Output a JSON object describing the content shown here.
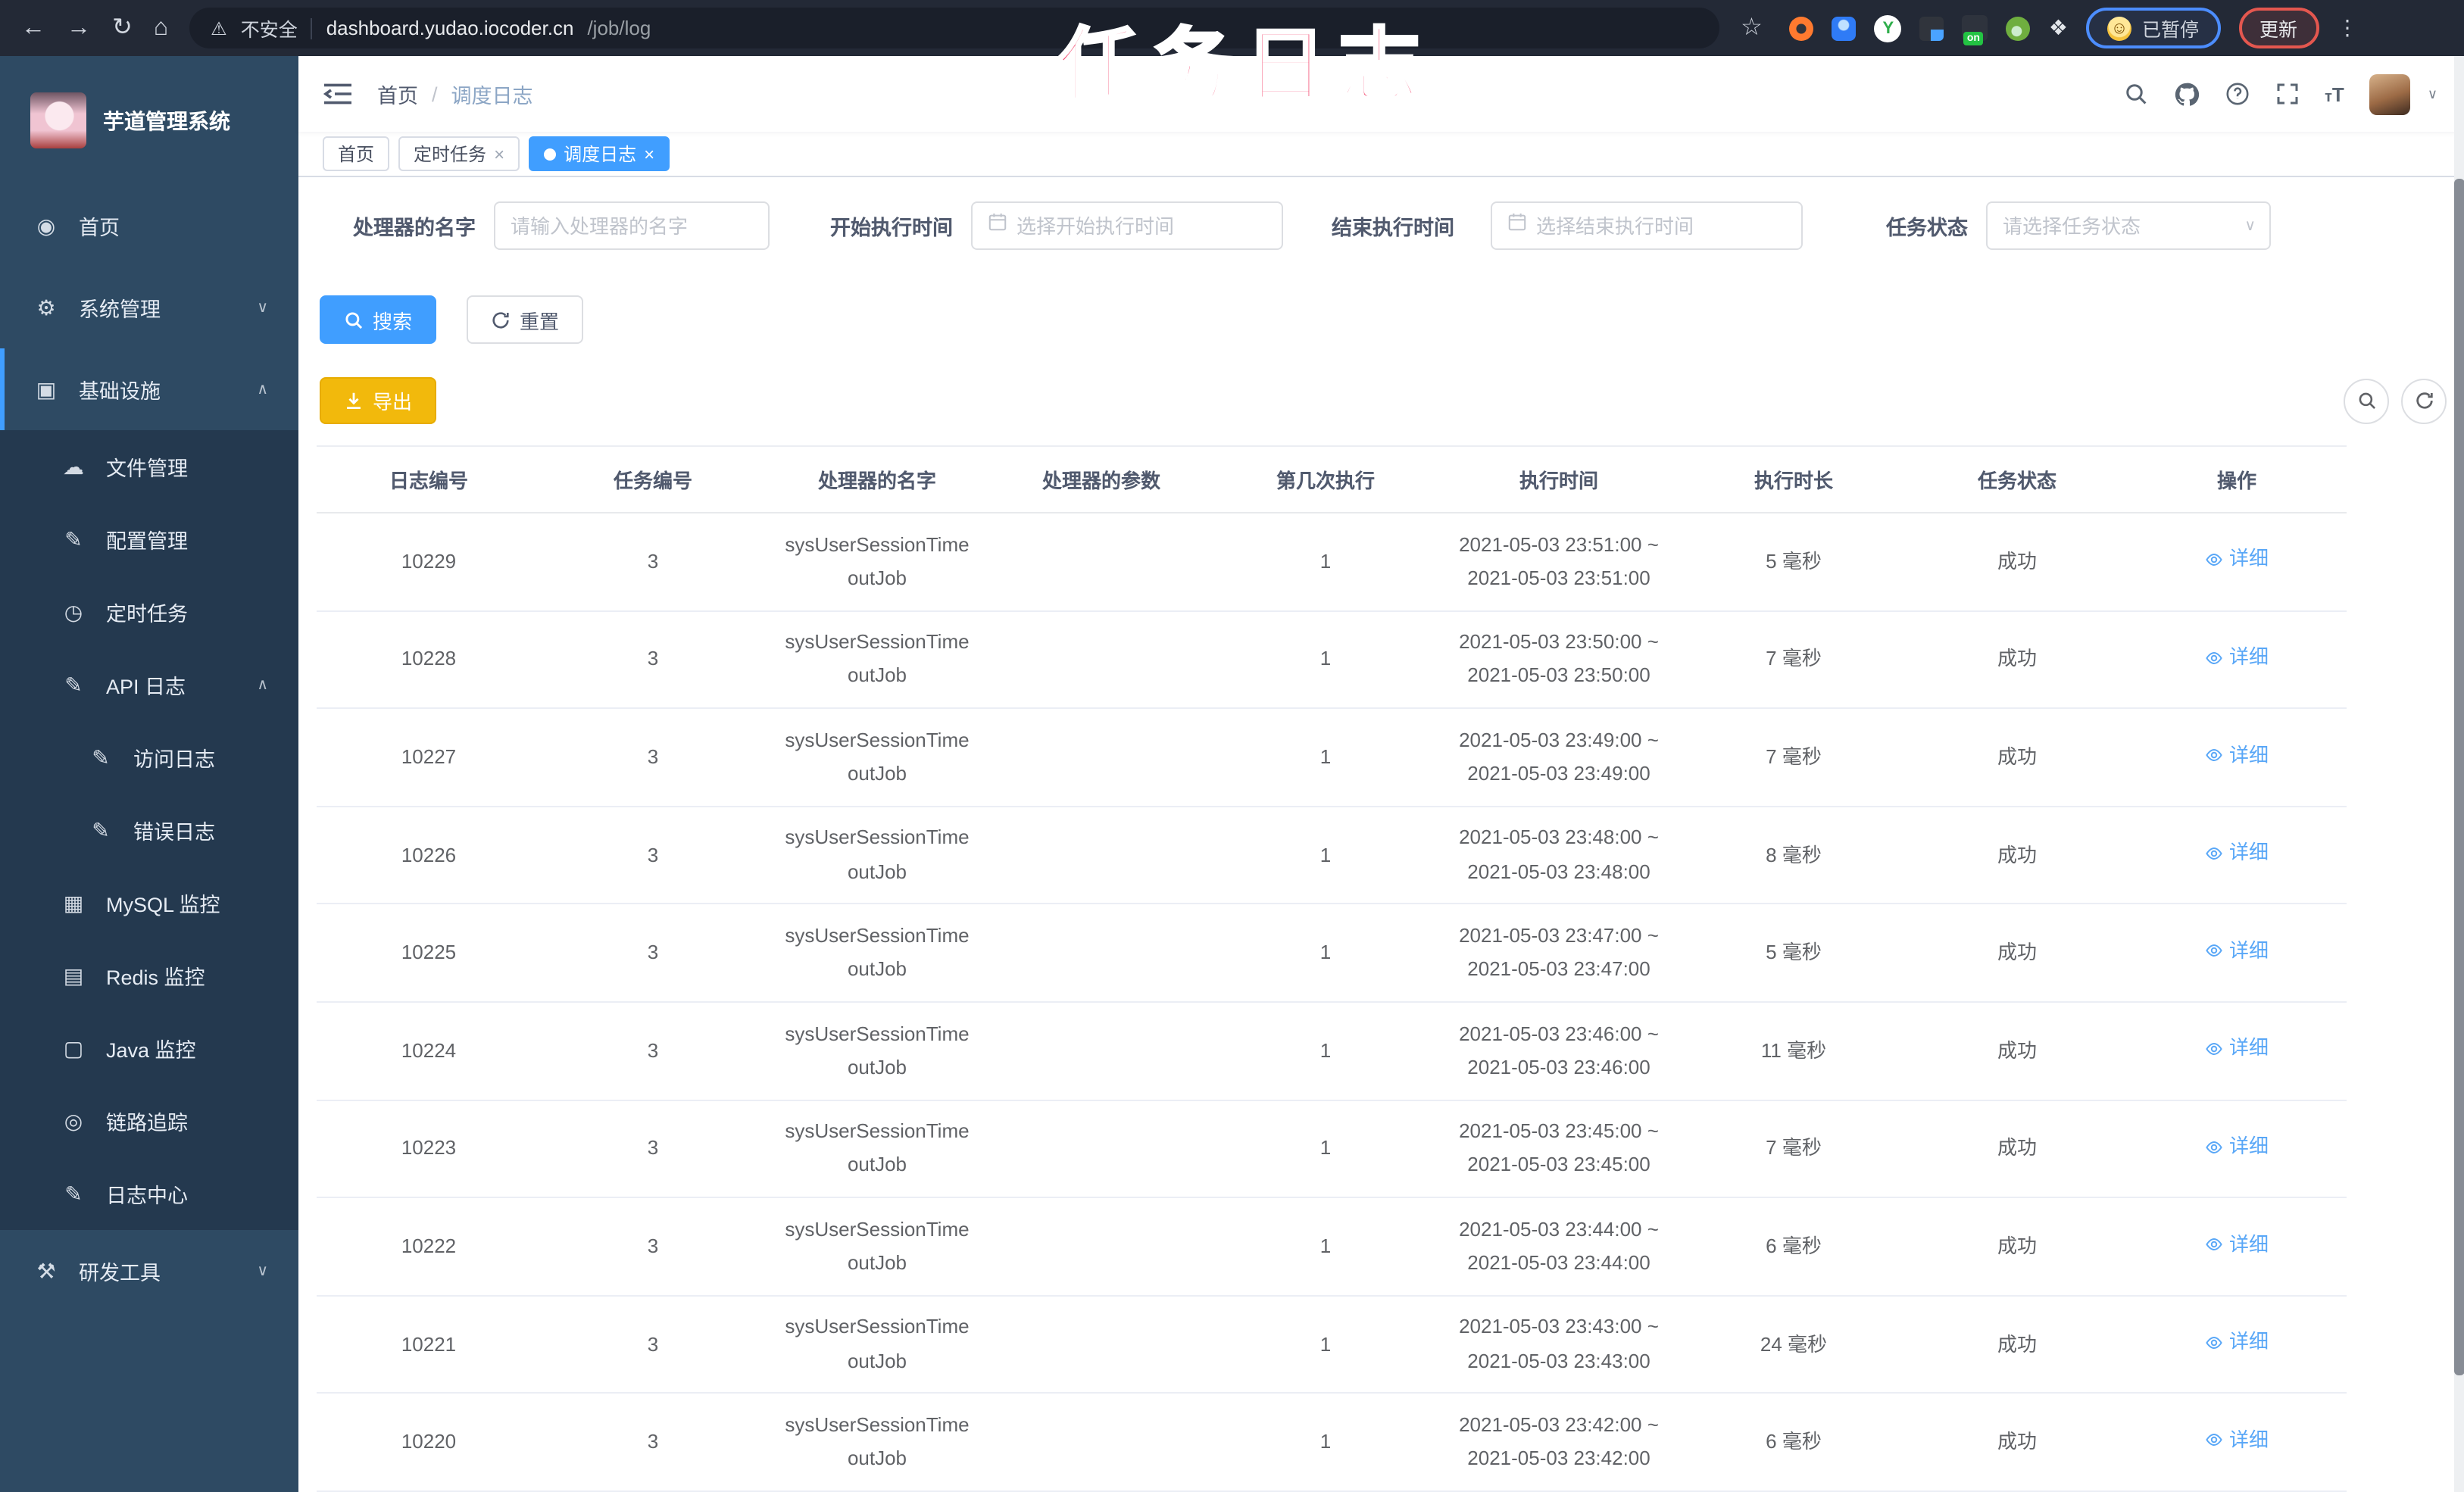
{
  "colors": {
    "accent": "#409eff",
    "warning_button": "#f2b90c",
    "annotation_pink": "#f23a64",
    "sidebar_bg": "#2e4a63",
    "sidebar_submenu_bg": "#24394f",
    "browser_bar_bg": "#232936",
    "active_tab_bg": "#409eff"
  },
  "browser": {
    "security_label": "不安全",
    "url_host": "dashboard.yudao.iocoder.cn",
    "url_path": "/job/log",
    "paused_label": "已暂停",
    "update_label": "更新",
    "extension_y_label": "Y",
    "extension_on_label": "on",
    "emoji_face_glyph": "☺",
    "back_glyph": "←",
    "forward_glyph": "→",
    "reload_glyph": "↻",
    "home_glyph": "⌂",
    "warning_glyph": "⚠",
    "star_glyph": "☆",
    "kebab_glyph": "⋮"
  },
  "annotation": {
    "title": "任务日志"
  },
  "sidebar": {
    "app_title": "芋道管理系统",
    "items": [
      {
        "label": "首页",
        "icon": "home-icon",
        "glyph": "◉",
        "arrow": "",
        "classes": "lvl1"
      },
      {
        "label": "系统管理",
        "icon": "system-gear-icon",
        "glyph": "⚙",
        "arrow": "∨",
        "classes": "lvl1"
      },
      {
        "label": "基础设施",
        "icon": "infrastructure-icon",
        "glyph": "▣",
        "arrow": "∧",
        "classes": "lvl1 active-section"
      },
      {
        "label": "文件管理",
        "icon": "file-cloud-icon",
        "glyph": "☁",
        "arrow": "",
        "classes": "lvl2"
      },
      {
        "label": "配置管理",
        "icon": "config-edit-icon",
        "glyph": "✎",
        "arrow": "",
        "classes": "lvl2"
      },
      {
        "label": "定时任务",
        "icon": "timer-icon",
        "glyph": "◷",
        "arrow": "",
        "classes": "lvl2"
      },
      {
        "label": "API 日志",
        "icon": "api-log-icon",
        "glyph": "✎",
        "arrow": "∧",
        "classes": "lvl2"
      },
      {
        "label": "访问日志",
        "icon": "access-log-icon",
        "glyph": "✎",
        "arrow": "",
        "classes": "lvl3"
      },
      {
        "label": "错误日志",
        "icon": "error-log-icon",
        "glyph": "✎",
        "arrow": "",
        "classes": "lvl3"
      },
      {
        "label": "MySQL 监控",
        "icon": "mysql-monitor-icon",
        "glyph": "▦",
        "arrow": "",
        "classes": "lvl2"
      },
      {
        "label": "Redis 监控",
        "icon": "redis-monitor-icon",
        "glyph": "▤",
        "arrow": "",
        "classes": "lvl2"
      },
      {
        "label": "Java 监控",
        "icon": "java-monitor-icon",
        "glyph": "▢",
        "arrow": "",
        "classes": "lvl2"
      },
      {
        "label": "链路追踪",
        "icon": "trace-eye-icon",
        "glyph": "◎",
        "arrow": "",
        "classes": "lvl2"
      },
      {
        "label": "日志中心",
        "icon": "log-center-icon",
        "glyph": "✎",
        "arrow": "",
        "classes": "lvl2"
      },
      {
        "label": "研发工具",
        "icon": "dev-tools-icon",
        "glyph": "⚒",
        "arrow": "∨",
        "classes": "lvl1"
      }
    ]
  },
  "header": {
    "breadcrumb_home": "首页",
    "breadcrumb_sep": "/",
    "breadcrumb_current": "调度日志",
    "font_size_icon_small": "т",
    "font_size_icon_large": "T",
    "avatar_caret": "∨"
  },
  "tabs": [
    {
      "label": "首页",
      "close": "",
      "classes": ""
    },
    {
      "label": "定时任务",
      "close": "×",
      "classes": ""
    },
    {
      "label": "调度日志",
      "close": "×",
      "classes": "active"
    }
  ],
  "filters": [
    {
      "label": "处理器的名字",
      "placeholder": "请输入处理器的名字",
      "classes": "type-text g1"
    },
    {
      "label": "开始执行时间",
      "placeholder": "选择开始执行时间",
      "classes": "type-date g2"
    },
    {
      "label": "结束执行时间",
      "placeholder": "选择结束执行时间",
      "classes": "type-date g3"
    },
    {
      "label": "任务状态",
      "placeholder": "请选择任务状态",
      "classes": "type-select g4",
      "caret": "∨"
    }
  ],
  "actions": {
    "search_label": "搜索",
    "reset_label": "重置",
    "export_label": "导出"
  },
  "table": {
    "columns": [
      {
        "label": "日志编号"
      },
      {
        "label": "任务编号"
      },
      {
        "label": "处理器的名字"
      },
      {
        "label": "处理器的参数"
      },
      {
        "label": "第几次执行"
      },
      {
        "label": "执行时间"
      },
      {
        "label": "执行时长"
      },
      {
        "label": "任务状态"
      },
      {
        "label": "操作"
      }
    ],
    "rows": [
      {
        "log_id": "10229",
        "job_id": "3",
        "handler": "sysUserSessionTimeoutJob",
        "param": "",
        "exec_index": "1",
        "time1": "2021-05-03 23:51:00 ~",
        "time2": "2021-05-03 23:51:00",
        "duration": "5 毫秒",
        "status": "成功",
        "action": "详细"
      },
      {
        "log_id": "10228",
        "job_id": "3",
        "handler": "sysUserSessionTimeoutJob",
        "param": "",
        "exec_index": "1",
        "time1": "2021-05-03 23:50:00 ~",
        "time2": "2021-05-03 23:50:00",
        "duration": "7 毫秒",
        "status": "成功",
        "action": "详细"
      },
      {
        "log_id": "10227",
        "job_id": "3",
        "handler": "sysUserSessionTimeoutJob",
        "param": "",
        "exec_index": "1",
        "time1": "2021-05-03 23:49:00 ~",
        "time2": "2021-05-03 23:49:00",
        "duration": "7 毫秒",
        "status": "成功",
        "action": "详细"
      },
      {
        "log_id": "10226",
        "job_id": "3",
        "handler": "sysUserSessionTimeoutJob",
        "param": "",
        "exec_index": "1",
        "time1": "2021-05-03 23:48:00 ~",
        "time2": "2021-05-03 23:48:00",
        "duration": "8 毫秒",
        "status": "成功",
        "action": "详细"
      },
      {
        "log_id": "10225",
        "job_id": "3",
        "handler": "sysUserSessionTimeoutJob",
        "param": "",
        "exec_index": "1",
        "time1": "2021-05-03 23:47:00 ~",
        "time2": "2021-05-03 23:47:00",
        "duration": "5 毫秒",
        "status": "成功",
        "action": "详细"
      },
      {
        "log_id": "10224",
        "job_id": "3",
        "handler": "sysUserSessionTimeoutJob",
        "param": "",
        "exec_index": "1",
        "time1": "2021-05-03 23:46:00 ~",
        "time2": "2021-05-03 23:46:00",
        "duration": "11 毫秒",
        "status": "成功",
        "action": "详细"
      },
      {
        "log_id": "10223",
        "job_id": "3",
        "handler": "sysUserSessionTimeoutJob",
        "param": "",
        "exec_index": "1",
        "time1": "2021-05-03 23:45:00 ~",
        "time2": "2021-05-03 23:45:00",
        "duration": "7 毫秒",
        "status": "成功",
        "action": "详细"
      },
      {
        "log_id": "10222",
        "job_id": "3",
        "handler": "sysUserSessionTimeoutJob",
        "param": "",
        "exec_index": "1",
        "time1": "2021-05-03 23:44:00 ~",
        "time2": "2021-05-03 23:44:00",
        "duration": "6 毫秒",
        "status": "成功",
        "action": "详细"
      },
      {
        "log_id": "10221",
        "job_id": "3",
        "handler": "sysUserSessionTimeoutJob",
        "param": "",
        "exec_index": "1",
        "time1": "2021-05-03 23:43:00 ~",
        "time2": "2021-05-03 23:43:00",
        "duration": "24 毫秒",
        "status": "成功",
        "action": "详细"
      },
      {
        "log_id": "10220",
        "job_id": "3",
        "handler": "sysUserSessionTimeoutJob",
        "param": "",
        "exec_index": "1",
        "time1": "2021-05-03 23:42:00 ~",
        "time2": "2021-05-03 23:42:00",
        "duration": "6 毫秒",
        "status": "成功",
        "action": "详细"
      }
    ]
  }
}
